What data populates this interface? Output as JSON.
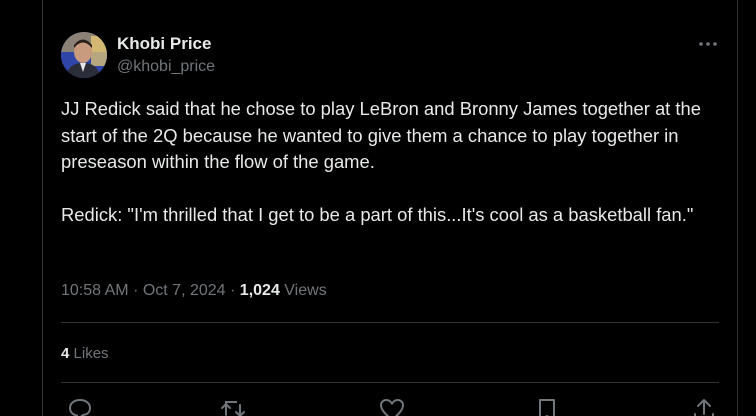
{
  "author": {
    "name": "Khobi Price",
    "handle": "@khobi_price"
  },
  "tweet": {
    "paragraphs": [
      "JJ Redick said that he chose to play LeBron and Bronny James together at the start of the 2Q because he wanted to give them a chance to play together in preseason within the flow of the game.",
      "Redick: \"I'm thrilled that I get to be a part of this...It's cool as a basketball fan.\""
    ]
  },
  "meta": {
    "time": "10:58 AM",
    "separator": "·",
    "date": "Oct 7, 2024",
    "views_count": "1,024",
    "views_label": "Views"
  },
  "engagement": {
    "likes_count": "4",
    "likes_label": "Likes"
  },
  "icons": {
    "more": "more-horizontal-icon",
    "reply": "reply-icon",
    "retweet": "retweet-icon",
    "like": "heart-icon",
    "bookmark": "bookmark-icon",
    "share": "share-icon"
  },
  "colors": {
    "background": "#000000",
    "text_primary": "#e7e9ea",
    "text_secondary": "#71767b",
    "border": "#2f3336"
  }
}
